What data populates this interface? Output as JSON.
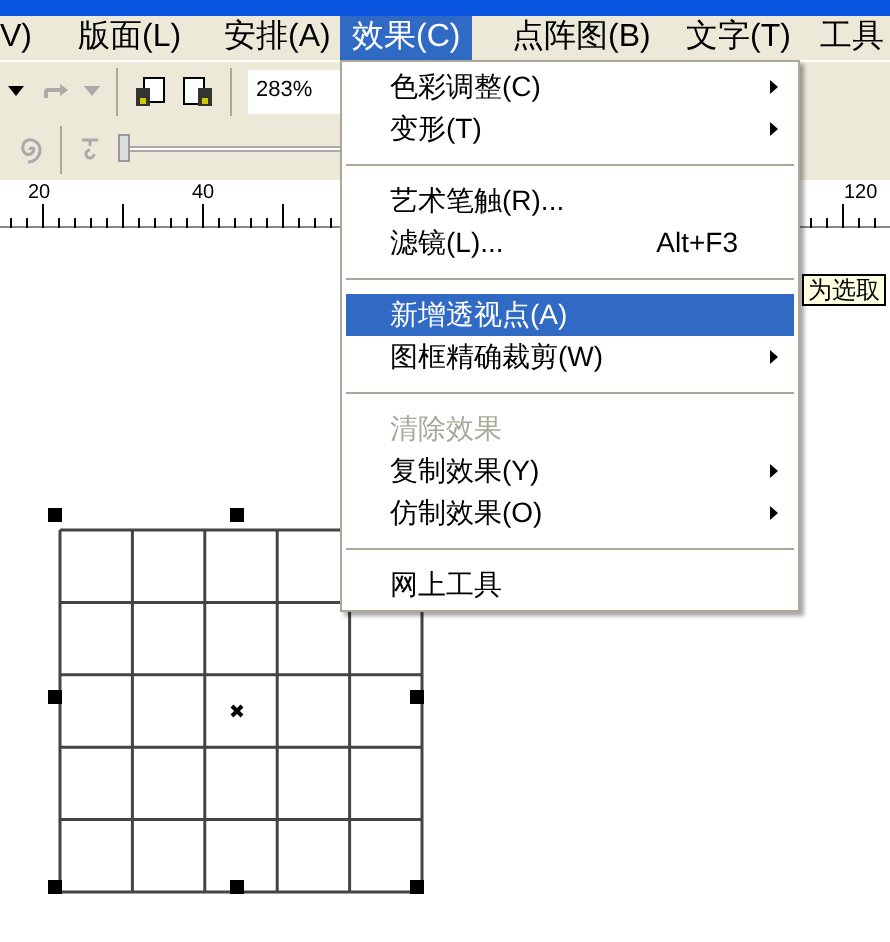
{
  "menu_bar": [
    {
      "label": "V)",
      "selected": false
    },
    {
      "label": "版面(L)",
      "selected": false
    },
    {
      "label": "安排(A)",
      "selected": false
    },
    {
      "label": "效果(C)",
      "selected": true
    },
    {
      "label": "点阵图(B)",
      "selected": false
    },
    {
      "label": "文字(T)",
      "selected": false
    },
    {
      "label": "工具",
      "selected": false
    }
  ],
  "toolbar": {
    "zoom": "283%"
  },
  "property_bar": {
    "slider": {
      "level": 0
    }
  },
  "ruler": {
    "labels": [
      "20",
      "40",
      "120"
    ]
  },
  "menu": [
    {
      "kind": "item",
      "label": "色彩调整(C)",
      "submenu": true,
      "selected": false,
      "disabled": false
    },
    {
      "kind": "item",
      "label": "变形(T)",
      "submenu": true,
      "selected": false,
      "disabled": false
    },
    {
      "kind": "separator"
    },
    {
      "kind": "item",
      "label": "艺术笔触(R)...",
      "submenu": false,
      "selected": false,
      "disabled": false
    },
    {
      "kind": "item",
      "label": "滤镜(L)...",
      "shortcut": "Alt+F3",
      "submenu": false,
      "selected": false,
      "disabled": false
    },
    {
      "kind": "separator"
    },
    {
      "kind": "item",
      "label": "新增透视点(A)",
      "submenu": false,
      "selected": true,
      "disabled": false
    },
    {
      "kind": "item",
      "label": "图框精确裁剪(W)",
      "submenu": true,
      "selected": false,
      "disabled": false
    },
    {
      "kind": "separator"
    },
    {
      "kind": "item",
      "label": "清除效果",
      "submenu": false,
      "selected": false,
      "disabled": true
    },
    {
      "kind": "item",
      "label": "复制效果(Y)",
      "submenu": true,
      "selected": false,
      "disabled": false
    },
    {
      "kind": "item",
      "label": "仿制效果(O)",
      "submenu": true,
      "selected": false,
      "disabled": false
    },
    {
      "kind": "separator"
    },
    {
      "kind": "item",
      "label": "网上工具",
      "submenu": false,
      "selected": false,
      "disabled": false
    }
  ],
  "tooltip": "为选取"
}
